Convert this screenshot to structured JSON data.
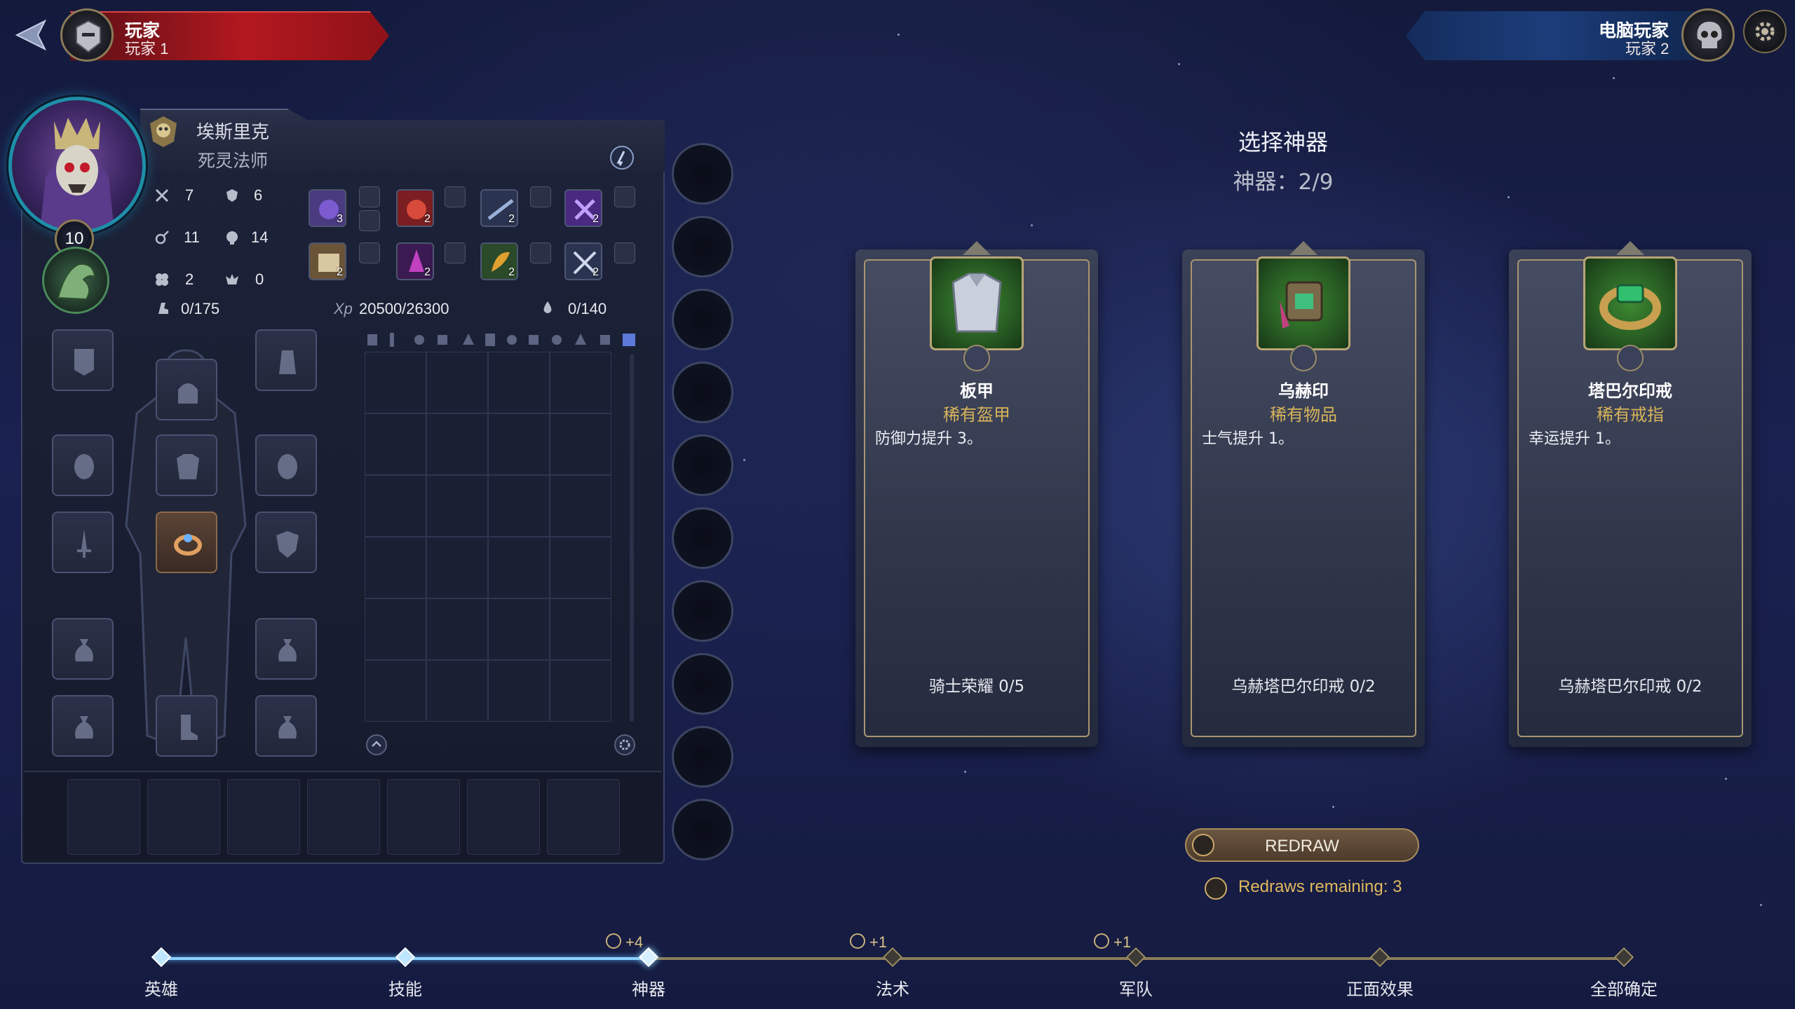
{
  "players": {
    "left": {
      "name": "玩家",
      "sub": "玩家 1",
      "color": "#b3181f"
    },
    "right": {
      "name": "电脑玩家",
      "sub": "玩家 2",
      "color": "#1c3d7a"
    }
  },
  "hero": {
    "name": "埃斯里克",
    "class": "死灵法师",
    "level": "10",
    "stats": {
      "attack": "7",
      "defense": "6",
      "spell_power": "11",
      "knowledge": "14",
      "luck": "2",
      "morale": "0"
    },
    "resources": {
      "movement": "0/175",
      "xp_label": "Xp",
      "xp": "20500/26300",
      "mana": "0/140"
    },
    "spells": [
      {
        "icon": "spell-icon",
        "count": "3",
        "color": "#6a4aa0"
      },
      {
        "icon": "spell-icon",
        "count": "2",
        "color": "#a0302e"
      },
      {
        "icon": "spell-icon",
        "count": "2",
        "color": "#3a4a6a"
      },
      {
        "icon": "spell-icon",
        "count": "2",
        "color": "#6a3aa0"
      },
      {
        "icon": "spell-icon",
        "count": "2",
        "color": "#8a7050"
      },
      {
        "icon": "spell-icon",
        "count": "2",
        "color": "#7a2a8a"
      },
      {
        "icon": "spell-icon",
        "count": "2",
        "color": "#3a7a3a"
      },
      {
        "icon": "spell-icon",
        "count": "2",
        "color": "#3a4a6a"
      }
    ]
  },
  "selection": {
    "title": "选择神器",
    "count": "神器：2/9",
    "cards": [
      {
        "name": "板甲",
        "rarity": "稀有盔甲",
        "desc": "防御力提升 3。",
        "set": "骑士荣耀 0/5",
        "icon": "armor-icon"
      },
      {
        "name": "乌赫印",
        "rarity": "稀有物品",
        "desc": "士气提升 1。",
        "set": "乌赫塔巴尔印戒 0/2",
        "icon": "seal-icon"
      },
      {
        "name": "塔巴尔印戒",
        "rarity": "稀有戒指",
        "desc": "幸运提升 1。",
        "set": "乌赫塔巴尔印戒 0/2",
        "icon": "ring-icon"
      }
    ],
    "redraw_label": "REDRAW",
    "redraws_remaining": "Redraws remaining: 3"
  },
  "progress": {
    "steps": [
      {
        "label": "英雄",
        "state": "done",
        "bonus": ""
      },
      {
        "label": "技能",
        "state": "done",
        "bonus": ""
      },
      {
        "label": "神器",
        "state": "current",
        "bonus": "+4"
      },
      {
        "label": "法术",
        "state": "todo",
        "bonus": "+1"
      },
      {
        "label": "军队",
        "state": "todo",
        "bonus": "+1"
      },
      {
        "label": "正面效果",
        "state": "todo",
        "bonus": ""
      },
      {
        "label": "全部确定",
        "state": "todo",
        "bonus": ""
      }
    ]
  }
}
